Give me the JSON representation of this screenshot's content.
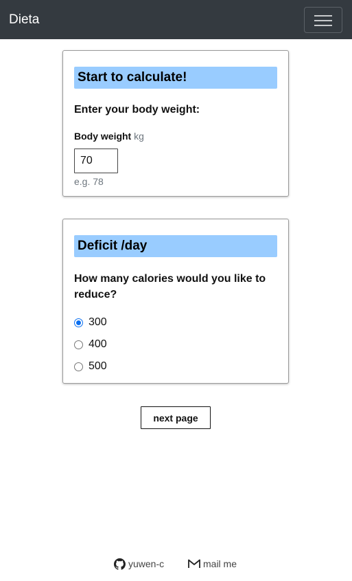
{
  "navbar": {
    "brand": "Dieta",
    "toggler_icon": "hamburger-menu-icon"
  },
  "weight_card": {
    "title": "Start to calculate!",
    "question": "Enter your body weight:",
    "field_label": "Body weight",
    "field_unit": "kg",
    "value": "70",
    "hint": "e.g. 78"
  },
  "deficit_card": {
    "title": "Deficit /day",
    "question_line1": "How many calories would you like to",
    "question_line2": "reduce?",
    "options": [
      {
        "label": "300",
        "checked": true
      },
      {
        "label": "400",
        "checked": false
      },
      {
        "label": "500",
        "checked": false
      }
    ]
  },
  "actions": {
    "next_label": "next page"
  },
  "footer": {
    "github_label": "yuwen-c",
    "github_icon": "github-icon",
    "mail_label": "mail me",
    "mail_icon": "mail-icon"
  },
  "colors": {
    "navbar_bg": "#343a40",
    "card_header_bg": "#99ccff",
    "radio_accent": "#0b6ff0"
  }
}
